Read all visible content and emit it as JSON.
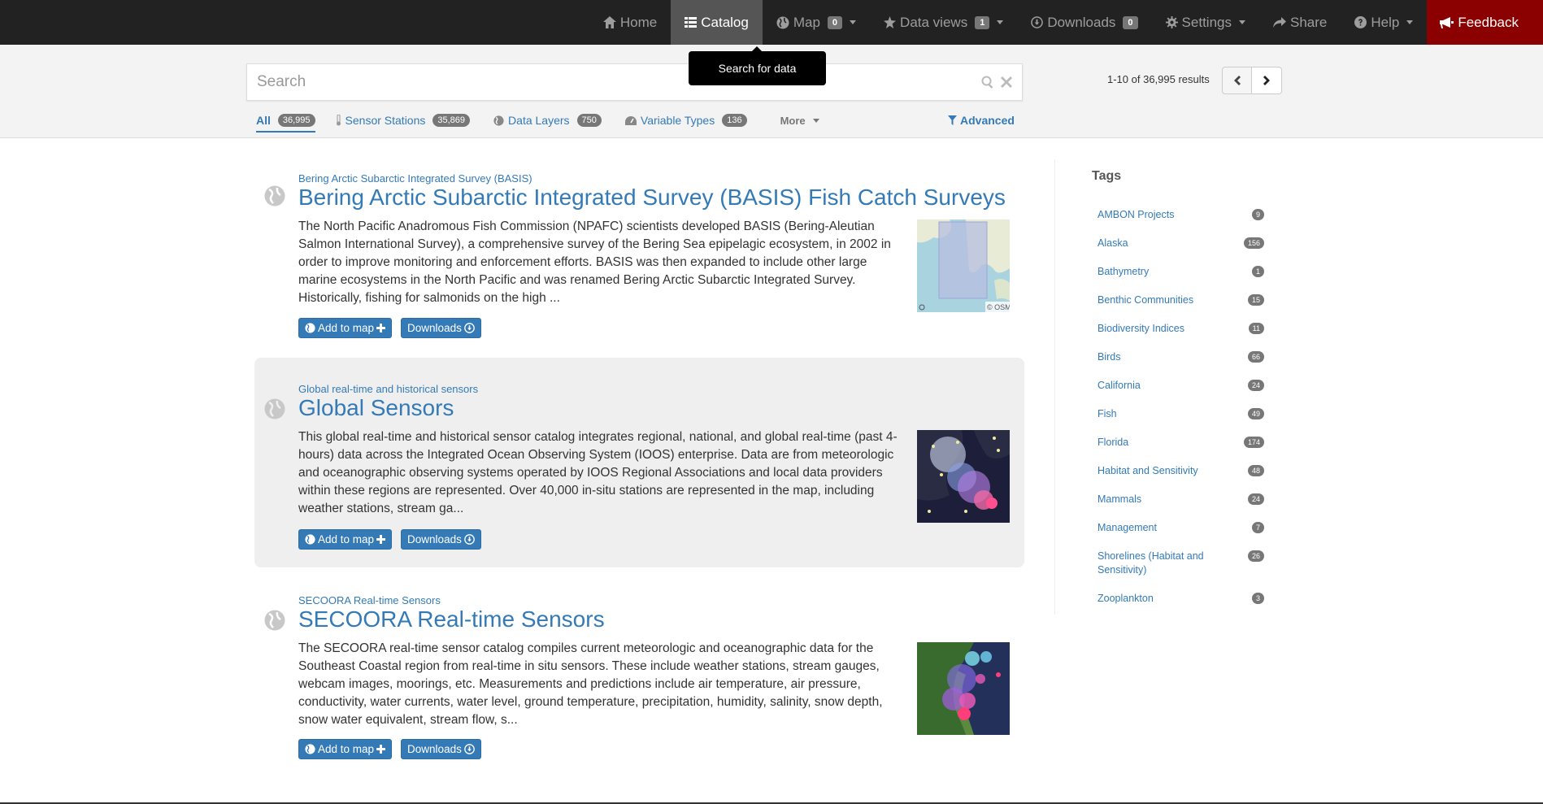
{
  "nav": {
    "home": "Home",
    "catalog": "Catalog",
    "map": "Map",
    "map_count": "0",
    "data_views": "Data views",
    "data_views_count": "1",
    "downloads": "Downloads",
    "downloads_count": "0",
    "settings": "Settings",
    "share": "Share",
    "help": "Help",
    "feedback": "Feedback"
  },
  "tooltip": "Search for data",
  "search": {
    "placeholder": "Search",
    "results_count": "1-10 of 36,995 results"
  },
  "filters": {
    "all": "All",
    "all_count": "36,995",
    "sensor_stations": "Sensor Stations",
    "sensor_stations_count": "35,869",
    "data_layers": "Data Layers",
    "data_layers_count": "750",
    "variable_types": "Variable Types",
    "variable_types_count": "136",
    "more": "More",
    "advanced": "Advanced"
  },
  "results": [
    {
      "source": "Bering Arctic Subarctic Integrated Survey (BASIS)",
      "title": "Bering Arctic Subarctic Integrated Survey (BASIS) Fish Catch Surveys",
      "description": "The North Pacific Anadromous Fish Commission (NPAFC) scientists developed BASIS (Bering-Aleutian Salmon International Survey), a comprehensive survey of the Bering Sea epipelagic ecosystem, in 2002 in order to improve monitoring and enforcement efforts. BASIS was then expanded to include other large marine ecosystems in the North Pacific and was renamed Bering Arctic Subarctic Integrated Survey. Historically, fishing for salmonids on the high ...",
      "add_to_map": "Add to map",
      "downloads": "Downloads",
      "thumb_credit": "© OSM"
    },
    {
      "source": "Global real-time and historical sensors",
      "title": "Global Sensors",
      "description": "This global real-time and historical sensor catalog integrates regional, national, and global real-time (past 4-hours) data across the Integrated Ocean Observing System (IOOS) enterprise. Data are from meteorologic and oceanographic observing systems operated by IOOS Regional Associations and local data providers within these regions are represented. Over 40,000 in-situ stations are represented in the map, including weather stations, stream ga...",
      "add_to_map": "Add to map",
      "downloads": "Downloads"
    },
    {
      "source": "SECOORA Real-time Sensors",
      "title": "SECOORA Real-time Sensors",
      "description": "The SECOORA real-time sensor catalog compiles current meteorologic and oceanographic data for the Southeast Coastal region from real-time in situ sensors. These include weather stations, stream gauges, webcam images, moorings, etc. Measurements and predictions include air temperature, air pressure, conductivity, water currents, water level, ground temperature, precipitation, humidity, salinity, snow depth, snow water equivalent, stream flow, s...",
      "add_to_map": "Add to map",
      "downloads": "Downloads"
    }
  ],
  "tags": {
    "title": "Tags",
    "items": [
      {
        "name": "AMBON Projects",
        "count": "9"
      },
      {
        "name": "Alaska",
        "count": "156"
      },
      {
        "name": "Bathymetry",
        "count": "1"
      },
      {
        "name": "Benthic Communities",
        "count": "15"
      },
      {
        "name": "Biodiversity Indices",
        "count": "11"
      },
      {
        "name": "Birds",
        "count": "66"
      },
      {
        "name": "California",
        "count": "24"
      },
      {
        "name": "Fish",
        "count": "49"
      },
      {
        "name": "Florida",
        "count": "174"
      },
      {
        "name": "Habitat and Sensitivity",
        "count": "48"
      },
      {
        "name": "Mammals",
        "count": "24"
      },
      {
        "name": "Management",
        "count": "7"
      },
      {
        "name": "Shorelines (Habitat and Sensitivity)",
        "count": "26"
      },
      {
        "name": "Zooplankton",
        "count": "3"
      }
    ]
  },
  "colors": {
    "navbar": "#222222",
    "link": "#337ab7",
    "feedback": "#8b0000",
    "badge": "#777777"
  }
}
